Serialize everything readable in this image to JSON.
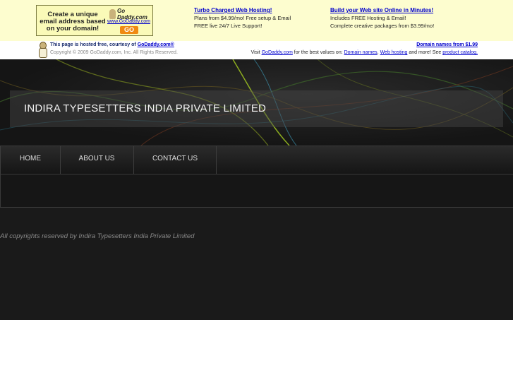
{
  "ad": {
    "box_text": "Create a unique email address based on your domain!",
    "box_logo": "Go Daddy.com",
    "box_url": "www.GoDaddy.com",
    "box_go": "GO",
    "col1": {
      "link": "Turbo Charged Web Hosting!",
      "line1": "Plans from $4.99/mo! Free setup & Email",
      "line2": "FREE live 24/7 Live Support!"
    },
    "col2": {
      "link": "Build your Web site Online in Minutes!",
      "line1": "Includes FREE Hosting & Email!",
      "line2": "Complete creative packages from $3.99/mo!"
    }
  },
  "courtesy": {
    "hosted_prefix": "This page is hosted free, courtesy of ",
    "hosted_link": "GoDaddy.com®",
    "copyright": "Copyright © 2009 GoDaddy.com, Inc. All Rights Reserved.",
    "domain_link": "Domain names from $1.99",
    "visit_prefix": "Visit ",
    "visit_link": "GoDaddy.com",
    "visit_mid": " for the best values on: ",
    "link_domain": "Domain names",
    "comma": ", ",
    "link_hosting": "Web hosting",
    "visit_more": " and more! See ",
    "link_catalog": "product catalog."
  },
  "site": {
    "title": "INDIRA TYPESETTERS INDIA PRIVATE LIMITED",
    "nav": [
      "HOME",
      "ABOUT US",
      "CONTACT US"
    ],
    "footer": "All copyrights reserved by Indira Typesetters India Private Limited"
  },
  "colors": {
    "ad_background": "#fdfdcf",
    "site_background": "#1a1a1a",
    "link": "#0000cc"
  }
}
